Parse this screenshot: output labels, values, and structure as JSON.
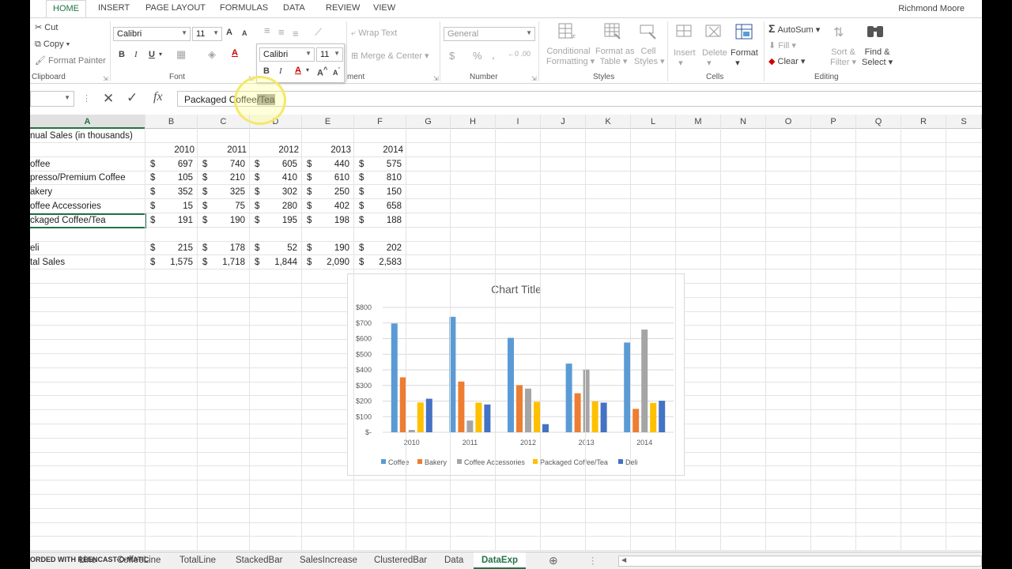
{
  "ribbon_tabs": [
    "HOME",
    "INSERT",
    "PAGE LAYOUT",
    "FORMULAS",
    "DATA",
    "REVIEW",
    "VIEW"
  ],
  "user_name": "Richmond Moore",
  "clipboard": {
    "cut": "Cut",
    "copy": "Copy",
    "format_painter": "Format Painter",
    "label": "Clipboard"
  },
  "font": {
    "name": "Calibri",
    "size": "11",
    "label": "Font",
    "bold": "B",
    "italic": "I",
    "underline": "U",
    "grow": "A",
    "shrink": "A"
  },
  "mini_toolbar": {
    "font": "Calibri",
    "size": "11",
    "bold": "B",
    "italic": "I"
  },
  "alignment": {
    "wrap_text": "Wrap Text",
    "merge_center": "Merge & Center",
    "label_tail": "ment"
  },
  "number": {
    "format": "General",
    "currency": "$",
    "percent": "%",
    "comma": ",",
    "label": "Number"
  },
  "styles": {
    "conditional": "Conditional",
    "formatting": "Formatting",
    "format_as": "Format as",
    "table": "Table",
    "cell": "Cell",
    "cell_styles": "Styles",
    "label": "Styles"
  },
  "cells": {
    "insert": "Insert",
    "delete": "Delete",
    "format": "Format",
    "label": "Cells"
  },
  "editing": {
    "autosum": "AutoSum",
    "fill": "Fill",
    "clear": "Clear",
    "sort": "Sort &",
    "filter": "Filter",
    "find": "Find &",
    "select": "Select",
    "label": "Editing"
  },
  "formula_bar": {
    "cancel": "✕",
    "enter": "✓",
    "fx": "fx",
    "text_before": "Packaged Coffee",
    "text_selected": "/Tea"
  },
  "columns": [
    "A",
    "B",
    "C",
    "D",
    "E",
    "F",
    "G",
    "H",
    "I",
    "J",
    "K",
    "L",
    "M",
    "N",
    "O",
    "P",
    "Q",
    "R",
    "S"
  ],
  "sheet": {
    "title": "nual Sales (in thousands)",
    "years": [
      "2010",
      "2011",
      "2012",
      "2013",
      "2014"
    ],
    "currency": "$",
    "rows": [
      {
        "label": "offee",
        "values": [
          "697",
          "740",
          "605",
          "440",
          "575"
        ]
      },
      {
        "label": "presso/Premium Coffee",
        "values": [
          "105",
          "210",
          "410",
          "610",
          "810"
        ]
      },
      {
        "label": "akery",
        "values": [
          "352",
          "325",
          "302",
          "250",
          "150"
        ]
      },
      {
        "label": "offee Accessories",
        "values": [
          "15",
          "75",
          "280",
          "402",
          "658"
        ]
      },
      {
        "label": "ckaged Coffee/Tea",
        "values": [
          "191",
          "190",
          "195",
          "198",
          "188"
        ]
      },
      {
        "label": "",
        "values": []
      },
      {
        "label": "eli",
        "values": [
          "215",
          "178",
          "52",
          "190",
          "202"
        ]
      },
      {
        "label": "tal Sales",
        "values": [
          "1,575",
          "1,718",
          "1,844",
          "2,090",
          "2,583"
        ]
      }
    ]
  },
  "chart_data": {
    "type": "bar",
    "title": "Chart Title",
    "categories": [
      "2010",
      "2011",
      "2012",
      "2013",
      "2014"
    ],
    "ylim": [
      0,
      800
    ],
    "yticks": [
      "$-",
      "$100",
      "$200",
      "$300",
      "$400",
      "$500",
      "$600",
      "$700",
      "$800"
    ],
    "series": [
      {
        "name": "Coffee",
        "color": "#5b9bd5",
        "values": [
          697,
          740,
          605,
          440,
          575
        ]
      },
      {
        "name": "Bakery",
        "color": "#ed7d31",
        "values": [
          352,
          325,
          302,
          250,
          150
        ]
      },
      {
        "name": "Coffee Accessories",
        "color": "#a5a5a5",
        "values": [
          15,
          75,
          280,
          402,
          658
        ]
      },
      {
        "name": "Packaged Coffee/Tea",
        "color": "#ffc000",
        "values": [
          191,
          190,
          195,
          198,
          188
        ]
      },
      {
        "name": "Deli",
        "color": "#4472c4",
        "values": [
          215,
          178,
          52,
          190,
          202
        ]
      }
    ],
    "legend": "bottom",
    "grid": true
  },
  "sheet_tabs": [
    "Line",
    "CoffeeLine",
    "TotalLine",
    "StackedBar",
    "SalesIncrease",
    "ClusteredBar",
    "Data",
    "DataExp"
  ],
  "watermark": "ORDED WITH  REENCAST-O-MATIC"
}
